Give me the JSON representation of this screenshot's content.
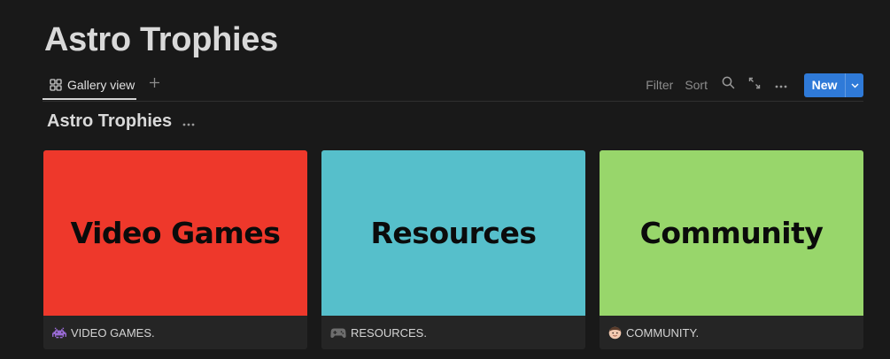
{
  "page": {
    "title": "Astro Trophies"
  },
  "views": {
    "active_tab_label": "Gallery view"
  },
  "toolbar": {
    "filter_label": "Filter",
    "sort_label": "Sort",
    "new_label": "New"
  },
  "database": {
    "title": "Astro Trophies"
  },
  "cards": [
    {
      "cover_text": "Video Games",
      "cover_color": "#ee382b",
      "title": "VIDEO GAMES.",
      "icon": "space-invader-icon"
    },
    {
      "cover_text": "Resources",
      "cover_color": "#56bfcb",
      "title": "RESOURCES.",
      "icon": "game-controller-icon"
    },
    {
      "cover_text": "Community",
      "cover_color": "#98d66b",
      "title": "COMMUNITY.",
      "icon": "person-face-icon"
    }
  ],
  "colors": {
    "background": "#191919",
    "accent": "#2f7ad8"
  }
}
